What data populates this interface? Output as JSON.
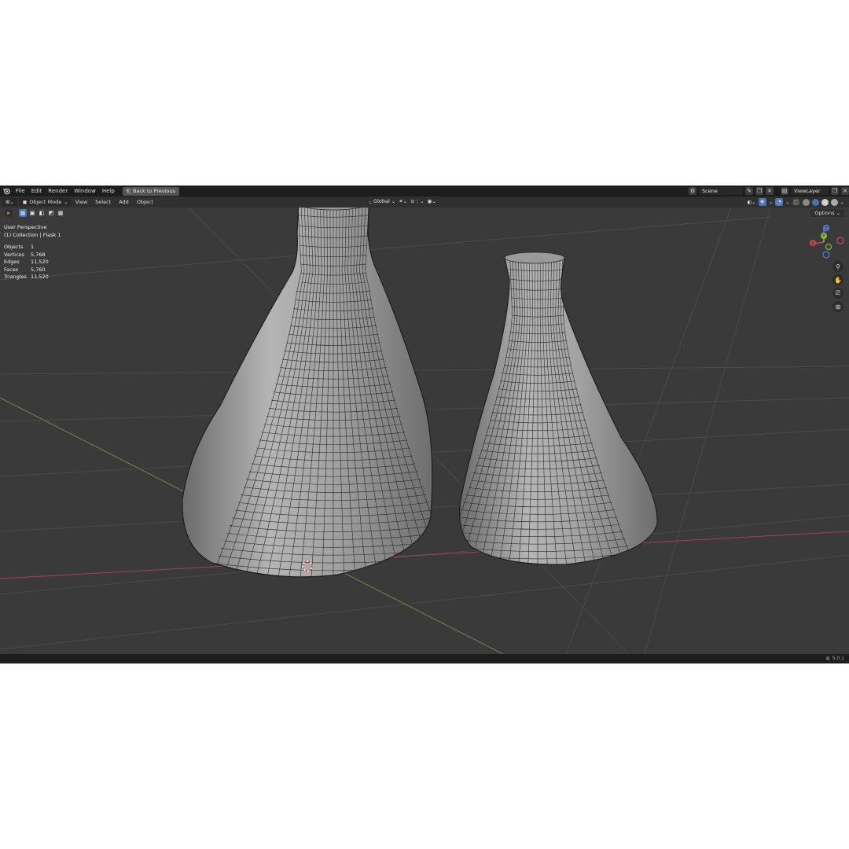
{
  "menu": {
    "items": [
      "File",
      "Edit",
      "Render",
      "Window",
      "Help"
    ],
    "back_button": "Back to Previous"
  },
  "topbar_right": {
    "scene": "Scene",
    "view_layer": "ViewLayer"
  },
  "header": {
    "mode": "Object Mode",
    "menus": [
      "View",
      "Select",
      "Add",
      "Object"
    ],
    "transform_orientation": "Global",
    "options_label": "Options"
  },
  "overlay": {
    "perspective": "User Perspective",
    "collection": "(1) Collection | Flask 1"
  },
  "stats": [
    {
      "label": "Objects",
      "value": "1"
    },
    {
      "label": "Vertices",
      "value": "5,768"
    },
    {
      "label": "Edges",
      "value": "11,520"
    },
    {
      "label": "Faces",
      "value": "5,760"
    },
    {
      "label": "Triangles",
      "value": "11,520"
    }
  ],
  "gizmo": {
    "x": "X",
    "y": "Y",
    "z": "Z"
  },
  "status": {
    "version": "5.0.1"
  },
  "colors": {
    "viewport_bg": "#3a3a3a",
    "x_axis": "#a8424c",
    "y_axis": "#6a8c3a",
    "accent": "#4772b3"
  },
  "icons": [
    "blender-logo-icon",
    "back-icon",
    "editor-type-icon",
    "object-mode-icon",
    "transform-icon",
    "snap-icon",
    "proportional-icon",
    "gizmo-icon",
    "overlay-icon",
    "xray-icon",
    "zoom-icon",
    "hand-pan-icon",
    "camera-icon",
    "grid-icon",
    "globe-icon"
  ]
}
